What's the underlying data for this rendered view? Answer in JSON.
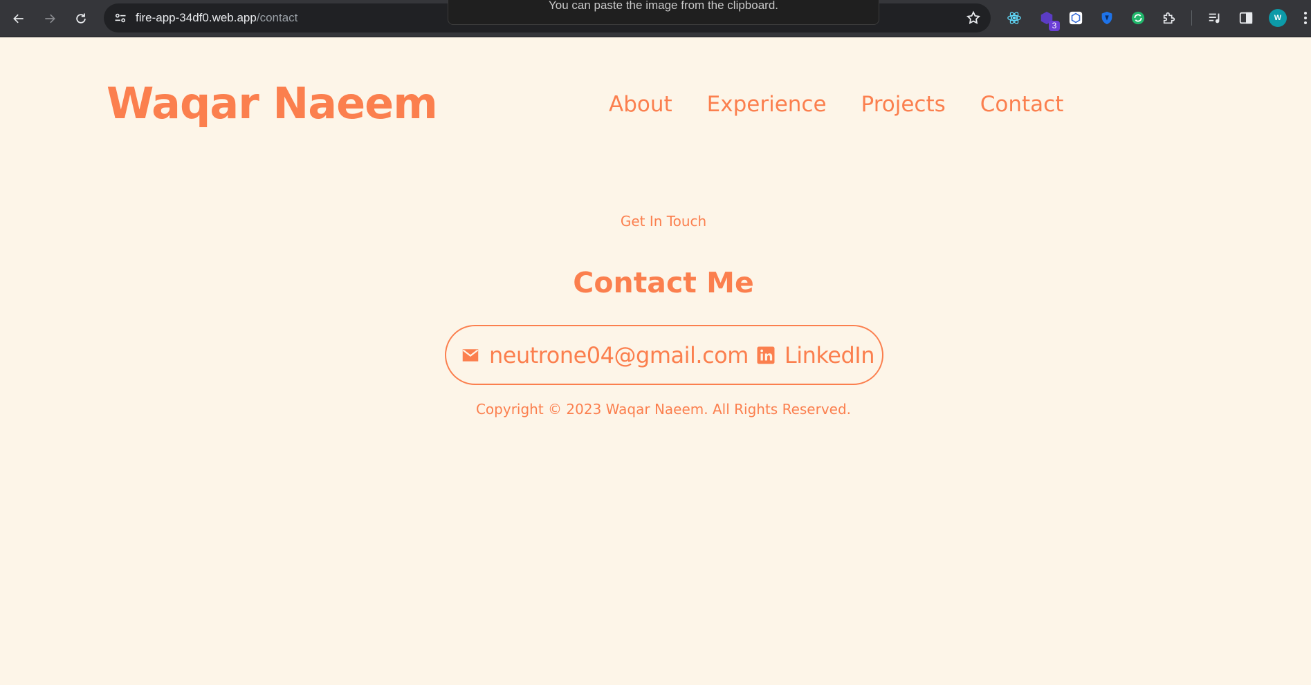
{
  "browser": {
    "url_host": "fire-app-34df0.web.app",
    "url_path": "/contact",
    "toast": "You can paste the image from the clipboard.",
    "extension_badge": "3",
    "avatar_initial": "W"
  },
  "header": {
    "brand": "Waqar Naeem",
    "nav": [
      "About",
      "Experience",
      "Projects",
      "Contact"
    ]
  },
  "contact": {
    "eyebrow": "Get In Touch",
    "title": "Contact Me",
    "email": "neutrone04@gmail.com",
    "linkedin": "LinkedIn"
  },
  "footer": {
    "copyright": "Copyright © 2023 Waqar Naeem. All Rights Reserved."
  },
  "colors": {
    "accent": "#fb7f4e",
    "page_bg": "#fdf5e8",
    "chrome_bg": "#35363a"
  }
}
